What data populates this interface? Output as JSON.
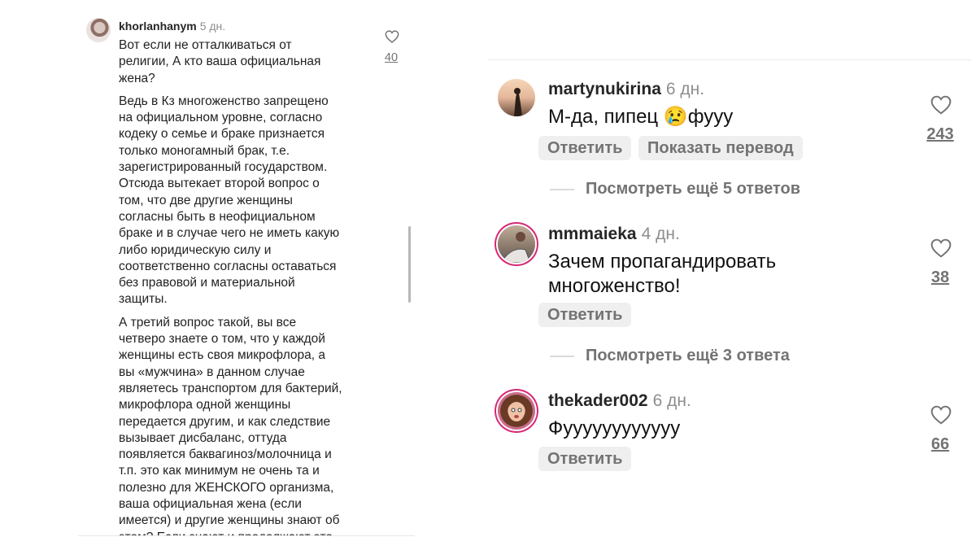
{
  "left_comment": {
    "username": "khorlanhanym",
    "time": "5 дн.",
    "paragraphs": [
      "Вот если не отталкиваться от\nрелигии, А кто ваша официальная\nжена?",
      "Ведь в Кз многоженство запрещено\nна официальном уровне, согласно\nкодеку о семье и браке признается\nтолько моногамный брак, т.е.\nзарегистрированный государством.\nОтсюда вытекает второй вопрос о\nтом, что две другие женщины\nсогласны быть в неофициальном\nбраке и в случае чего не иметь какую\nлибо юридическую силу и\nсоответственно согласны оставаться\nбез правовой и материальной\nзащиты.",
      "А третий вопрос такой, вы все\nчетверо знаете о том, что у каждой\nженщины есть своя микрофлора, а\nвы «мужчина» в данном случае\nявляетесь транспортом для бактерий,\nмикрофлора одной женщины\nпередается другим, и как следствие\nвызывает дисбаланс, оттуда\nпоявляется баквагиноз/молочница и\nт.п. это как минимум не очень та и\nполезно для ЖЕНСКОГО организма,\nваша официальная жена (если\nимеется) и другие женщины знают об\nэтом? Если знают и продолжают это,"
    ],
    "likes": "40",
    "heart_icon": "heart-outline-icon"
  },
  "comments": [
    {
      "username": "martynukirina",
      "time": "6 дн.",
      "text": "М-да, пипец 😢фууу",
      "reply_label": "Ответить",
      "translate_label": "Показать перевод",
      "likes": "243",
      "more_replies": "Посмотреть ещё 5 ответов"
    },
    {
      "username": "mmmaieka",
      "time": "4 дн.",
      "text": "Зачем пропагандировать\nмногоженство!",
      "reply_label": "Ответить",
      "likes": "38",
      "more_replies": "Посмотреть ещё 3 ответа"
    },
    {
      "username": "thekader002",
      "time": "6 дн.",
      "text": "Фуууууууууууу",
      "reply_label": "Ответить",
      "likes": "66"
    }
  ],
  "colors": {
    "story_ring": "#d62976",
    "muted": "#737373",
    "pill_bg": "#efefef"
  }
}
